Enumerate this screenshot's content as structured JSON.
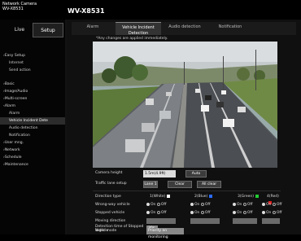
{
  "app": {
    "brand_line1": "Network Camera",
    "brand_line2": "WV-X8531",
    "model": "WV-X8531"
  },
  "sidebar": {
    "tab_live": "Live",
    "tab_setup": "Setup",
    "items": [
      {
        "label": "Easy Setup",
        "level": 0
      },
      {
        "label": "Internet",
        "level": 1
      },
      {
        "label": "Send action",
        "level": 1
      },
      {
        "label": "Basic",
        "level": 0
      },
      {
        "label": "Image/Audio",
        "level": 0
      },
      {
        "label": "Multi-screen",
        "level": 0
      },
      {
        "label": "Alarm",
        "level": 0
      },
      {
        "label": "Alarm",
        "level": 1
      },
      {
        "label": "Vehicle Incident Dete",
        "level": 1,
        "selected": true
      },
      {
        "label": "Audio detection",
        "level": 1
      },
      {
        "label": "Notification",
        "level": 1
      },
      {
        "label": "User mng.",
        "level": 0
      },
      {
        "label": "Network",
        "level": 0
      },
      {
        "label": "Schedule",
        "level": 0
      },
      {
        "label": "Maintenance",
        "level": 0
      }
    ]
  },
  "main": {
    "tabs": [
      {
        "label": "Alarm",
        "active": false
      },
      {
        "label": "Vehicle Incident\nDetection",
        "active": true
      },
      {
        "label": "Audio detection",
        "active": false
      },
      {
        "label": "Notification",
        "active": false
      }
    ],
    "notice": "*Any changes are applied immediately.",
    "controls": {
      "camera_height_label": "Camera height",
      "camera_height_value": "1.5m(4.9ft)",
      "auto_button": "Auto",
      "traffic_lane_label": "Traffic lane setup",
      "traffic_lane_button": "Lane 1",
      "clear_button": "Clear",
      "all_clear_button": "All clear",
      "direction_type_label": "Direction type",
      "directions": [
        {
          "label": "1(White)",
          "color": "#ffffff"
        },
        {
          "label": "2(Blue)",
          "color": "#2a6cff"
        },
        {
          "label": "3(Green)",
          "color": "#22cc33"
        },
        {
          "label": "4(Red)",
          "color": "#dd2222"
        }
      ],
      "wrong_way_label": "Wrong-way vehicle",
      "stopped_label": "Stopped vehicle",
      "moving_direction_label": "Moving direction",
      "detection_time_label": "Detection time of Stopped Vehicle",
      "detection_time_value": "30s",
      "night_mode_label": "Night mode",
      "night_mode_value": "Priority on monitoring",
      "on_label": "On",
      "off_label": "Off"
    }
  }
}
